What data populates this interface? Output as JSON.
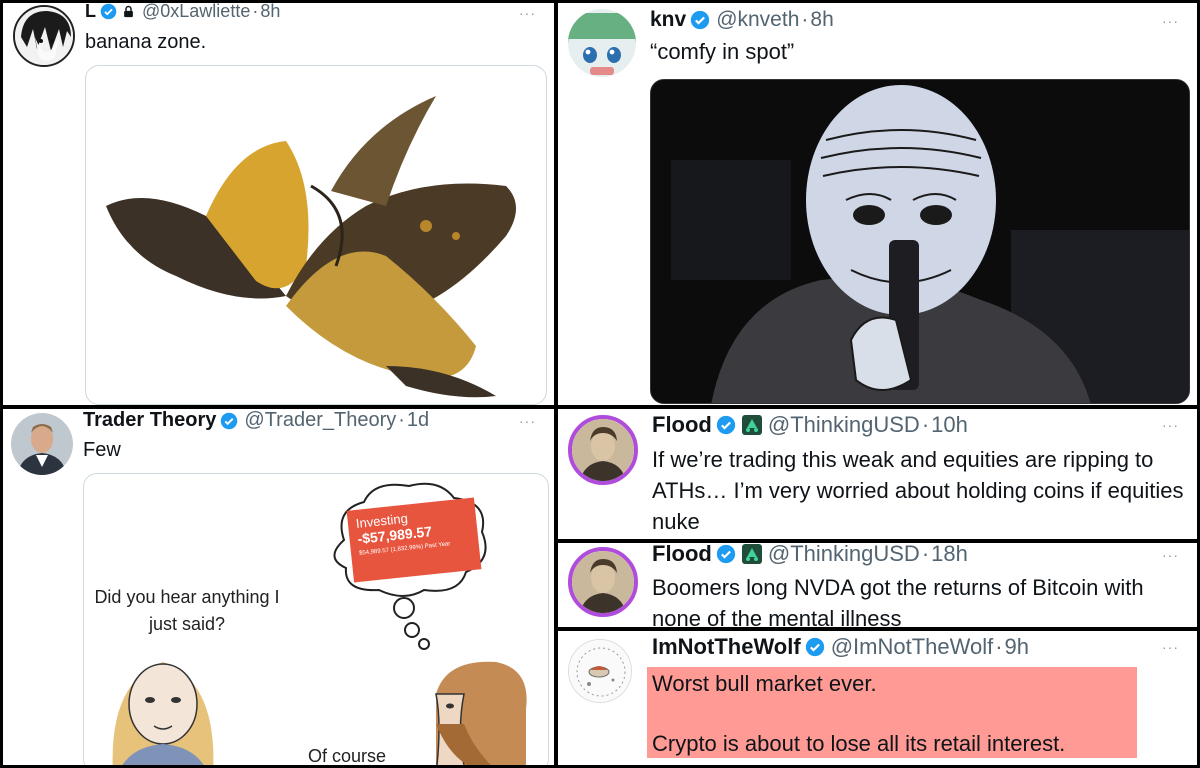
{
  "colors": {
    "accent_verified": "#1d9bf0",
    "highlight": "#ff9a95",
    "text": "#0f1419",
    "muted": "#536471"
  },
  "tweets": [
    {
      "name": "L",
      "handle": "@0xLawliette",
      "sep": "·",
      "time": "8h",
      "more": "···",
      "text": "banana zone.",
      "lock_icon": "lock-icon"
    },
    {
      "name": "knv",
      "handle": "@knveth",
      "sep": "·",
      "time": "8h",
      "more": "···",
      "text": "“comfy in spot”"
    },
    {
      "name": "Trader Theory",
      "handle": "@Trader_Theory",
      "sep": "·",
      "time": "1d",
      "more": "···",
      "text": "Few",
      "meme": {
        "speech": "Did you hear anything I just said?",
        "bubble_title": "Investing",
        "bubble_value": "-$57,989.57",
        "bubble_small": "$54,989.57 (1,832.99%) Past Year",
        "reply": "Of course"
      }
    },
    {
      "name": "Flood",
      "handle": "@ThinkingUSD",
      "sep": "·",
      "time": "10h",
      "more": "···",
      "text": "If we’re trading this weak and equities are ripping to ATHs… I’m very worried about holding coins if equities nuke"
    },
    {
      "name": "Flood",
      "handle": "@ThinkingUSD",
      "sep": "·",
      "time": "18h",
      "more": "···",
      "text": "Boomers long NVDA got the returns of Bitcoin with none of the mental illness"
    },
    {
      "name": "ImNotTheWolf",
      "handle": "@ImNotTheWolf",
      "sep": "·",
      "time": "9h",
      "more": "···",
      "line1": "Worst bull market ever.",
      "line2": "Crypto is about to lose all its retail interest."
    }
  ]
}
